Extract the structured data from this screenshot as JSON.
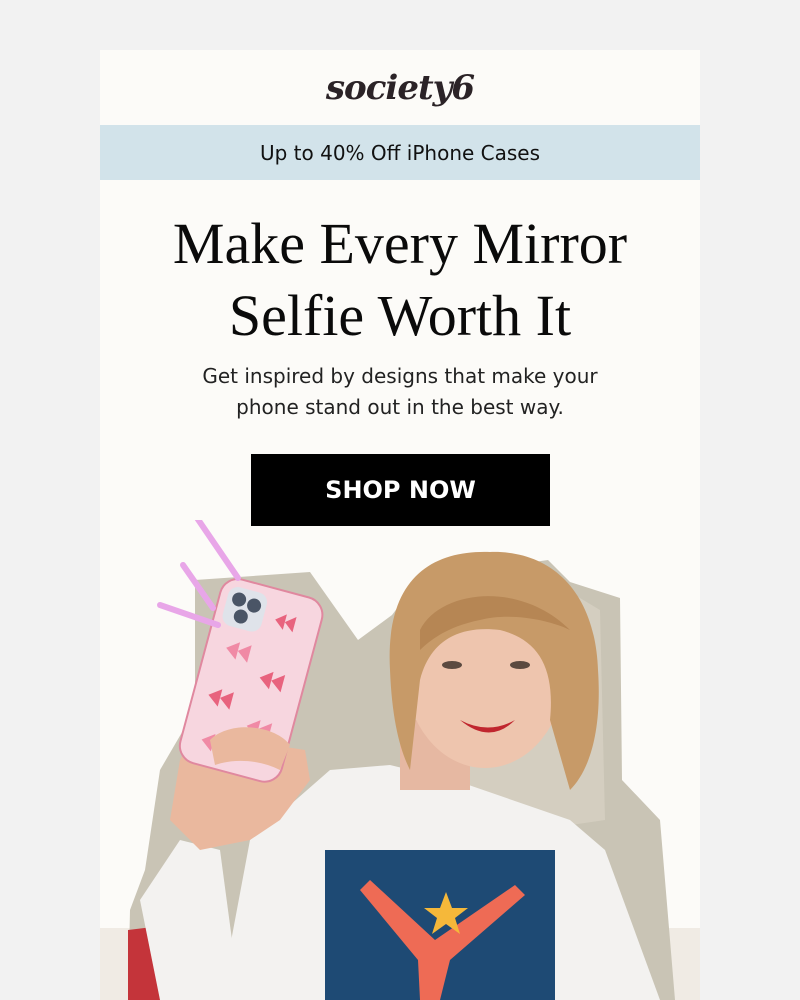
{
  "brand": {
    "logo": "society6"
  },
  "banner": {
    "text": "Up to 40% Off iPhone Cases"
  },
  "hero": {
    "headline_line1": "Make Every Mirror",
    "headline_line2": "Selfie Worth It",
    "subtext_line1": "Get inspired by designs that make your",
    "subtext_line2": "phone stand out in the best way.",
    "cta_label": "SHOP NOW"
  },
  "colors": {
    "background": "#f2f2f2",
    "card": "#fcfbf8",
    "banner": "#d2e3ea",
    "cta": "#000000",
    "accent_pink": "#e8a6e8",
    "phone_case_pink": "#f2a3bd"
  },
  "image": {
    "description_icon": "woman-selfie-photo"
  }
}
